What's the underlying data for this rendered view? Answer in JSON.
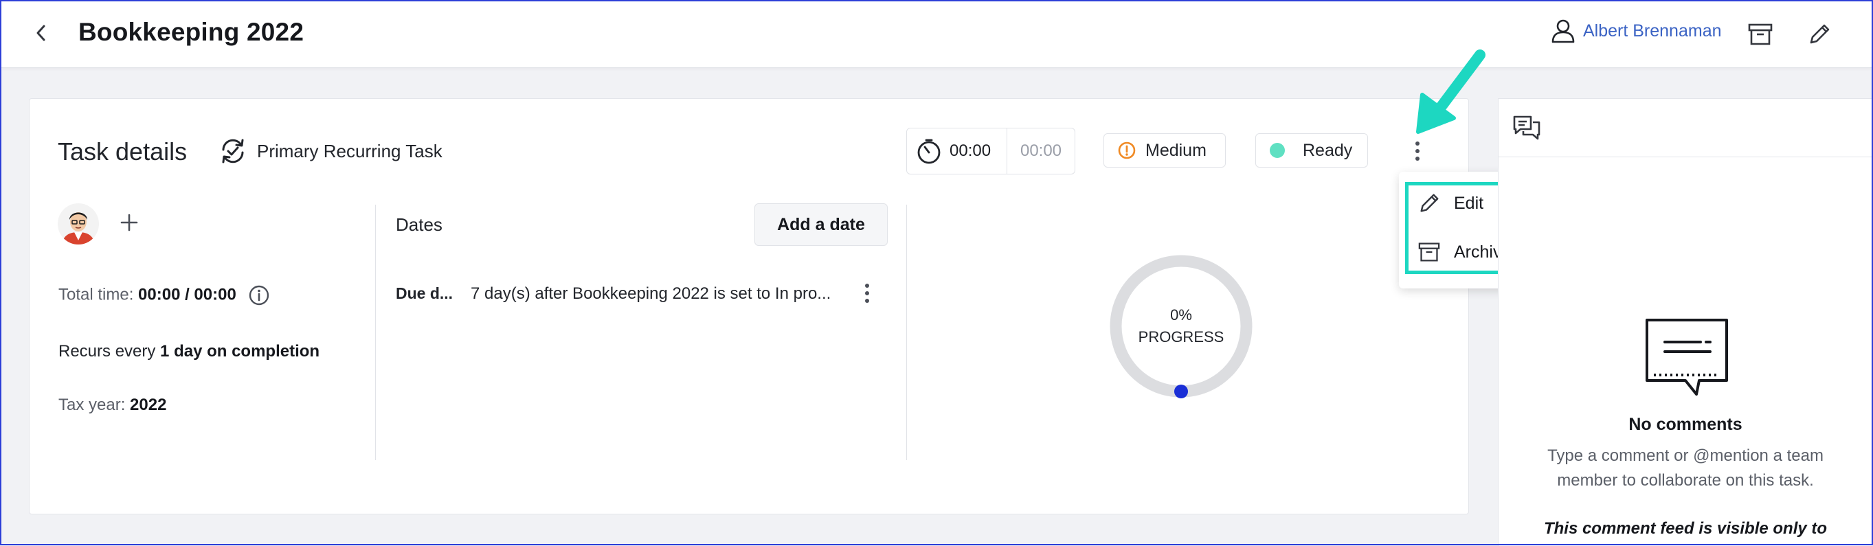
{
  "header": {
    "title": "Bookkeeping 2022",
    "user_name": "Albert Brennaman"
  },
  "task": {
    "section_title": "Task details",
    "recurring_label": "Primary Recurring Task",
    "timer_elapsed": "00:00",
    "timer_estimate": "00:00",
    "priority": "Medium",
    "status": "Ready",
    "total_time_label": "Total time:",
    "total_time_value": "00:00 / 00:00",
    "recurs_label": "Recurs every",
    "recurs_value": "1 day on completion",
    "tax_year_label": "Tax year:",
    "tax_year_value": "2022"
  },
  "dates": {
    "title": "Dates",
    "add_button": "Add a date",
    "due_label": "Due d...",
    "due_text": "7 day(s) after Bookkeeping 2022 is set to In pro..."
  },
  "progress": {
    "percent_text": "0%",
    "label": "PROGRESS",
    "value": 0
  },
  "menu": {
    "edit": "Edit",
    "archive": "Archive"
  },
  "comments": {
    "empty_title": "No comments",
    "empty_desc": "Type a comment or @mention a team member to collaborate on this task.",
    "visibility_note": "This comment feed is visible only to"
  },
  "colors": {
    "accent_teal": "#1dd7c1",
    "link_blue": "#3b63c4",
    "priority_orange": "#f08a24",
    "status_green": "#5fe0c2",
    "progress_dot": "#1a2fd6"
  }
}
